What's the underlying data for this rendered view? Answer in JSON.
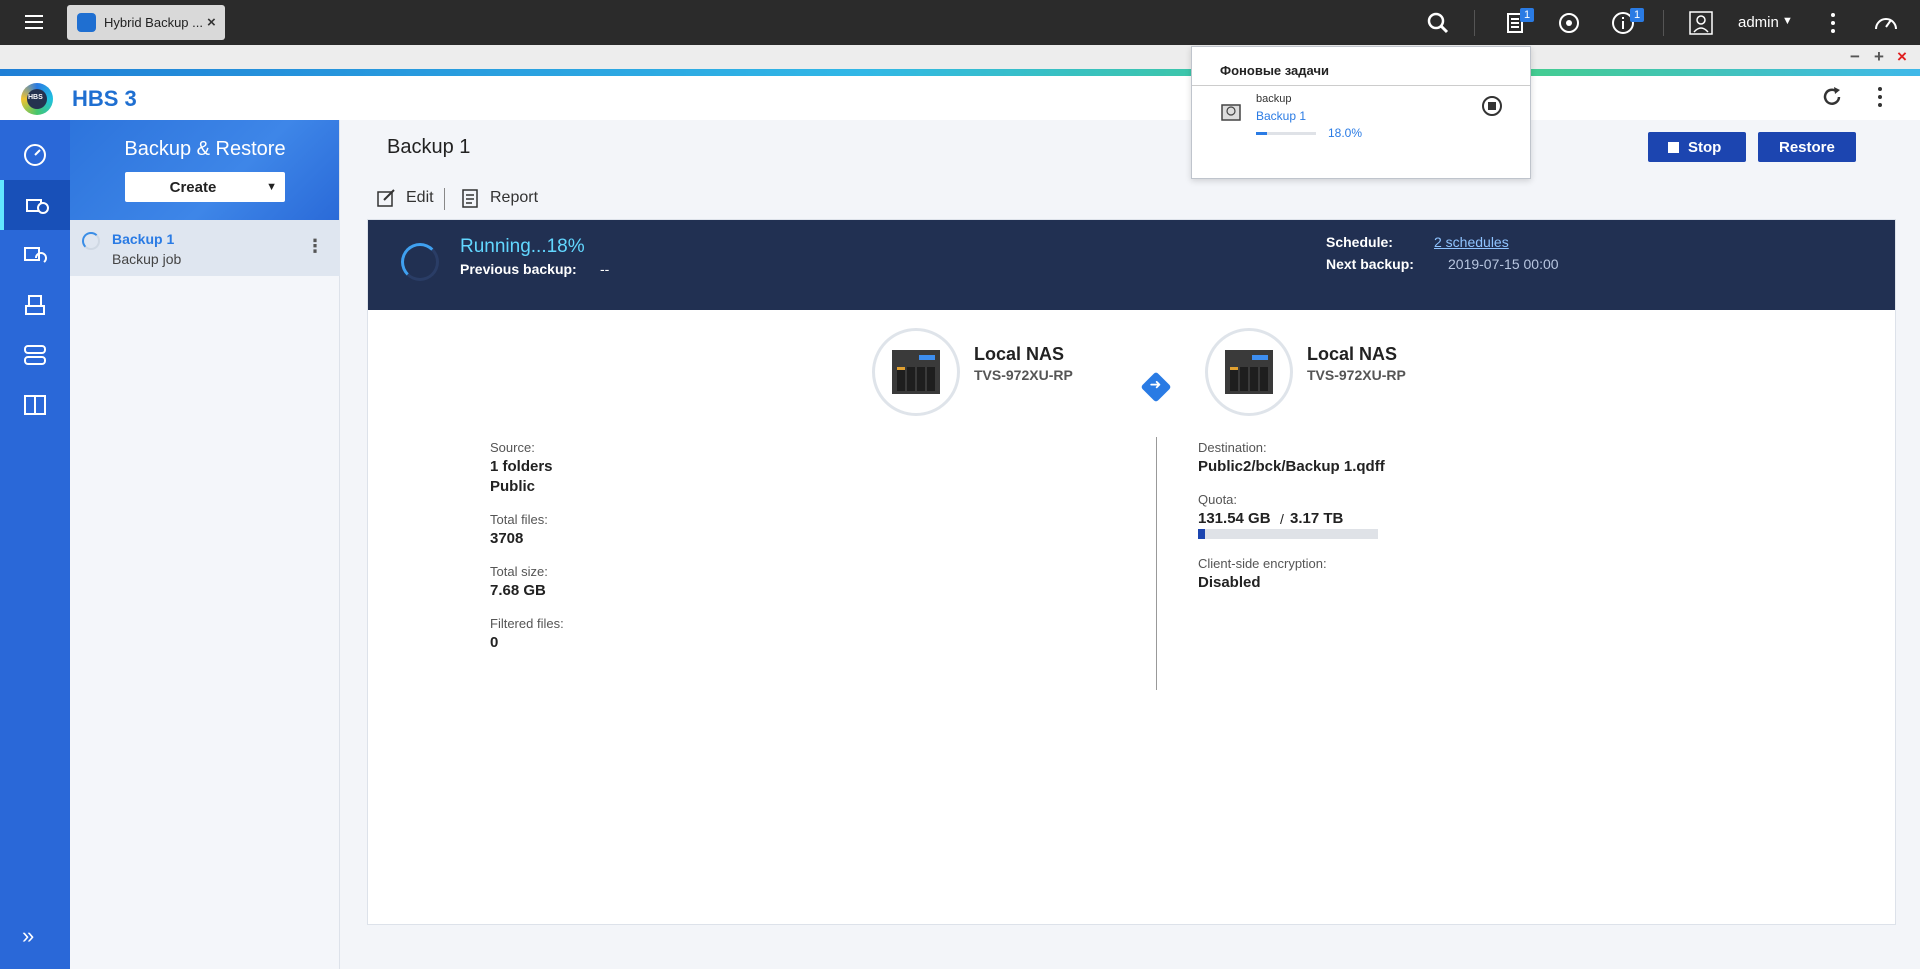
{
  "topbar": {
    "tab_label": "Hybrid Backup ...",
    "tab_close": "×",
    "badges": {
      "tasks": "1",
      "notifications": "1"
    },
    "user": "admin"
  },
  "window": {
    "minimize": "−",
    "maximize": "+",
    "close": "×"
  },
  "app": {
    "title": "HBS 3",
    "logo_text": "HBS"
  },
  "panel": {
    "title": "Backup & Restore",
    "create_label": "Create",
    "jobs": [
      {
        "name": "Backup 1",
        "type": "Backup job"
      }
    ]
  },
  "main": {
    "title": "Backup 1",
    "stop_label": "Stop",
    "restore_label": "Restore",
    "edit_label": "Edit",
    "report_label": "Report",
    "status": {
      "running": "Running...18%",
      "previous_label": "Previous backup:",
      "previous_value": "--",
      "schedule_label": "Schedule:",
      "schedule_value": "2 schedules",
      "next_label": "Next backup:",
      "next_value": "2019-07-15 00:00"
    },
    "source_nas": {
      "name": "Local NAS",
      "model": "TVS-972XU-RP"
    },
    "dest_nas": {
      "name": "Local NAS",
      "model": "TVS-972XU-RP"
    },
    "source": {
      "label": "Source:",
      "value1": "1 folders",
      "value2": "Public",
      "total_files_label": "Total files:",
      "total_files": "3708",
      "total_size_label": "Total size:",
      "total_size": "7.68 GB",
      "filtered_label": "Filtered files:",
      "filtered": "0"
    },
    "destination": {
      "label": "Destination:",
      "value": "Public2/bck/Backup 1.qdff",
      "quota_label": "Quota:",
      "quota_used": "131.54 GB",
      "quota_sep": "/",
      "quota_total": "3.17 TB",
      "quota_fraction": 0.04,
      "encryption_label": "Client-side encryption:",
      "encryption": "Disabled"
    }
  },
  "popup": {
    "title": "Фоновые задачи",
    "task_type": "backup",
    "task_name": "Backup 1",
    "progress_text": "18.0%",
    "progress": 0.18
  },
  "colors": {
    "rail": "#2a68d8",
    "status_bar": "#213052",
    "accent": "#2a7be4",
    "button": "#1c45b0"
  }
}
